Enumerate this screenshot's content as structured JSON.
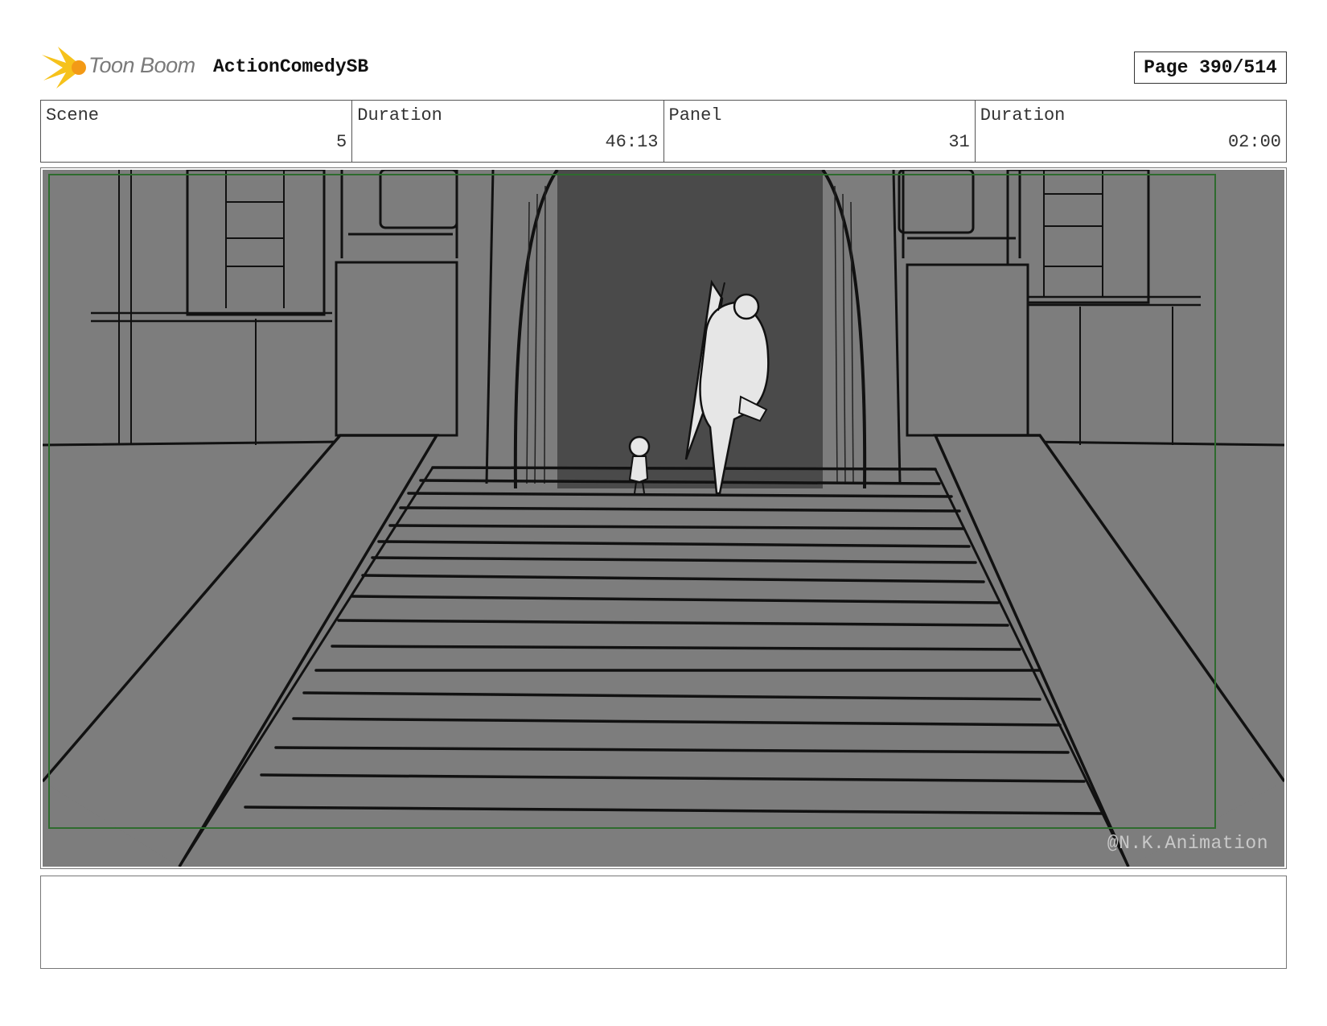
{
  "header": {
    "logo_text": "Toon Boom",
    "project_name": "ActionComedySB",
    "page_label": "Page 390/514"
  },
  "info": [
    {
      "label": "Scene",
      "value": "5"
    },
    {
      "label": "Duration",
      "value": "46:13"
    },
    {
      "label": "Panel",
      "value": "31"
    },
    {
      "label": "Duration",
      "value": "02:00"
    }
  ],
  "panel": {
    "watermark": "@N.K.Animation"
  },
  "notes": {
    "text": ""
  }
}
